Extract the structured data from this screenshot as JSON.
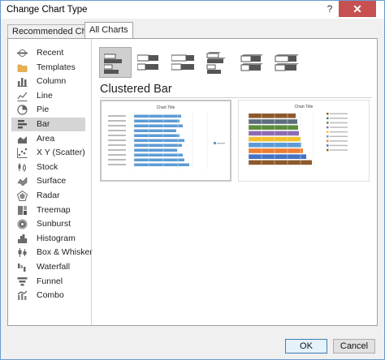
{
  "window": {
    "title": "Change Chart Type",
    "help_glyph": "?",
    "close_glyph": "✕"
  },
  "tabs": [
    {
      "label": "Recommended Charts"
    },
    {
      "label": "All Charts"
    }
  ],
  "sidebar": {
    "items": [
      {
        "label": "Recent",
        "icon": "recent-icon"
      },
      {
        "label": "Templates",
        "icon": "folder-icon"
      },
      {
        "label": "Column",
        "icon": "column-chart-icon"
      },
      {
        "label": "Line",
        "icon": "line-chart-icon"
      },
      {
        "label": "Pie",
        "icon": "pie-chart-icon"
      },
      {
        "label": "Bar",
        "icon": "bar-chart-icon",
        "selected": true
      },
      {
        "label": "Area",
        "icon": "area-chart-icon"
      },
      {
        "label": "X Y (Scatter)",
        "icon": "scatter-chart-icon"
      },
      {
        "label": "Stock",
        "icon": "stock-chart-icon"
      },
      {
        "label": "Surface",
        "icon": "surface-chart-icon"
      },
      {
        "label": "Radar",
        "icon": "radar-chart-icon"
      },
      {
        "label": "Treemap",
        "icon": "treemap-chart-icon"
      },
      {
        "label": "Sunburst",
        "icon": "sunburst-chart-icon"
      },
      {
        "label": "Histogram",
        "icon": "histogram-chart-icon"
      },
      {
        "label": "Box & Whisker",
        "icon": "box-whisker-chart-icon"
      },
      {
        "label": "Waterfall",
        "icon": "waterfall-chart-icon"
      },
      {
        "label": "Funnel",
        "icon": "funnel-chart-icon"
      },
      {
        "label": "Combo",
        "icon": "combo-chart-icon"
      }
    ]
  },
  "subtypes": [
    {
      "name": "clustered-bar",
      "selected": true
    },
    {
      "name": "stacked-bar"
    },
    {
      "name": "100-stacked-bar"
    },
    {
      "name": "3d-clustered-bar"
    },
    {
      "name": "3d-stacked-bar"
    },
    {
      "name": "3d-100-stacked-bar"
    }
  ],
  "selected_type": "Clustered Bar",
  "previews": [
    {
      "title": "Chart Title",
      "style": "single-series"
    },
    {
      "title": "Chart Title",
      "style": "multi-color"
    }
  ],
  "colors": {
    "accent_blue": "#5b9bd5",
    "selection_gray": "#d5d5d5",
    "close_red": "#c75050",
    "multi": [
      "#8c5a2b",
      "#5c6e7d",
      "#5c8c3c",
      "#8c6bb3",
      "#f2c12e",
      "#5b9bd5",
      "#ed7d31",
      "#4472c4"
    ]
  },
  "buttons": {
    "ok": "OK",
    "cancel": "Cancel"
  }
}
